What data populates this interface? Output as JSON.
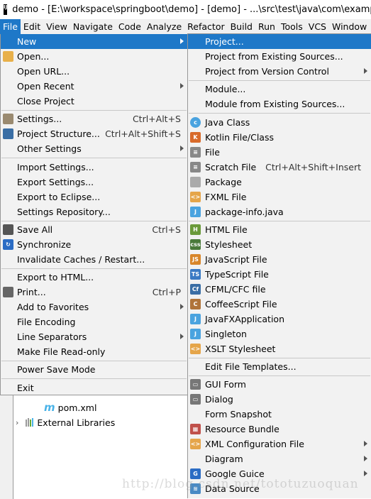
{
  "window": {
    "title": "demo - [E:\\workspace\\springboot\\demo] - [demo] - ...\\src\\test\\java\\com\\example\\demo",
    "logo": "IJ"
  },
  "menubar": [
    "File",
    "Edit",
    "View",
    "Navigate",
    "Code",
    "Analyze",
    "Refactor",
    "Build",
    "Run",
    "Tools",
    "VCS",
    "Window"
  ],
  "file_menu": [
    {
      "label": "New",
      "submenu": true,
      "selected": true
    },
    {
      "label": "Open...",
      "icon": "folder-icon"
    },
    {
      "label": "Open URL..."
    },
    {
      "label": "Open Recent",
      "submenu": true
    },
    {
      "label": "Close Project"
    },
    {
      "sep": true
    },
    {
      "label": "Settings...",
      "shortcut": "Ctrl+Alt+S",
      "icon": "wrench-icon"
    },
    {
      "label": "Project Structure...",
      "shortcut": "Ctrl+Alt+Shift+S",
      "icon": "project-structure-icon"
    },
    {
      "label": "Other Settings",
      "submenu": true
    },
    {
      "sep": true
    },
    {
      "label": "Import Settings..."
    },
    {
      "label": "Export Settings..."
    },
    {
      "label": "Export to Eclipse..."
    },
    {
      "label": "Settings Repository..."
    },
    {
      "sep": true
    },
    {
      "label": "Save All",
      "shortcut": "Ctrl+S",
      "icon": "save-icon"
    },
    {
      "label": "Synchronize",
      "icon": "sync-icon"
    },
    {
      "label": "Invalidate Caches / Restart..."
    },
    {
      "sep": true
    },
    {
      "label": "Export to HTML..."
    },
    {
      "label": "Print...",
      "shortcut": "Ctrl+P",
      "icon": "print-icon"
    },
    {
      "label": "Add to Favorites",
      "submenu": true
    },
    {
      "label": "File Encoding"
    },
    {
      "label": "Line Separators",
      "submenu": true
    },
    {
      "label": "Make File Read-only"
    },
    {
      "sep": true
    },
    {
      "label": "Power Save Mode"
    },
    {
      "sep": true
    },
    {
      "label": "Exit"
    }
  ],
  "new_submenu": [
    {
      "label": "Project...",
      "selected": true
    },
    {
      "label": "Project from Existing Sources..."
    },
    {
      "label": "Project from Version Control",
      "submenu": true
    },
    {
      "sep": true
    },
    {
      "label": "Module..."
    },
    {
      "label": "Module from Existing Sources..."
    },
    {
      "sep": true
    },
    {
      "label": "Java Class",
      "icon": "java-class-icon"
    },
    {
      "label": "Kotlin File/Class",
      "icon": "kotlin-file-icon"
    },
    {
      "label": "File",
      "icon": "file-icon"
    },
    {
      "label": "Scratch File",
      "shortcut": "Ctrl+Alt+Shift+Insert",
      "icon": "scratch-file-icon"
    },
    {
      "label": "Package",
      "icon": "package-folder-icon"
    },
    {
      "label": "FXML File",
      "icon": "fxml-file-icon"
    },
    {
      "label": "package-info.java",
      "icon": "java-file-icon"
    },
    {
      "sep": true
    },
    {
      "label": "HTML File",
      "icon": "html-file-icon"
    },
    {
      "label": "Stylesheet",
      "icon": "css-file-icon"
    },
    {
      "label": "JavaScript File",
      "icon": "js-file-icon"
    },
    {
      "label": "TypeScript File",
      "icon": "ts-file-icon"
    },
    {
      "label": "CFML/CFC file",
      "icon": "cfml-file-icon"
    },
    {
      "label": "CoffeeScript File",
      "icon": "coffeescript-file-icon"
    },
    {
      "label": "JavaFXApplication",
      "icon": "javafx-icon"
    },
    {
      "label": "Singleton",
      "icon": "singleton-icon"
    },
    {
      "label": "XSLT Stylesheet",
      "icon": "xslt-icon"
    },
    {
      "sep": true
    },
    {
      "label": "Edit File Templates..."
    },
    {
      "sep": true
    },
    {
      "label": "GUI Form",
      "icon": "gui-form-icon"
    },
    {
      "label": "Dialog",
      "icon": "dialog-icon"
    },
    {
      "label": "Form Snapshot"
    },
    {
      "label": "Resource Bundle",
      "icon": "resource-bundle-icon"
    },
    {
      "label": "XML Configuration File",
      "submenu": true,
      "icon": "xml-config-icon"
    },
    {
      "label": "Diagram",
      "submenu": true
    },
    {
      "label": "Google Guice",
      "submenu": true,
      "icon": "google-guice-icon"
    },
    {
      "label": "Data Source",
      "icon": "database-icon"
    }
  ],
  "tree": {
    "pom": "pom.xml",
    "external": "External Libraries"
  },
  "watermark": "http://blog.csdn.net/tototuzuoquan",
  "colors": {
    "accent": "#1e78c8",
    "menu_bg": "#f2f2f2"
  }
}
